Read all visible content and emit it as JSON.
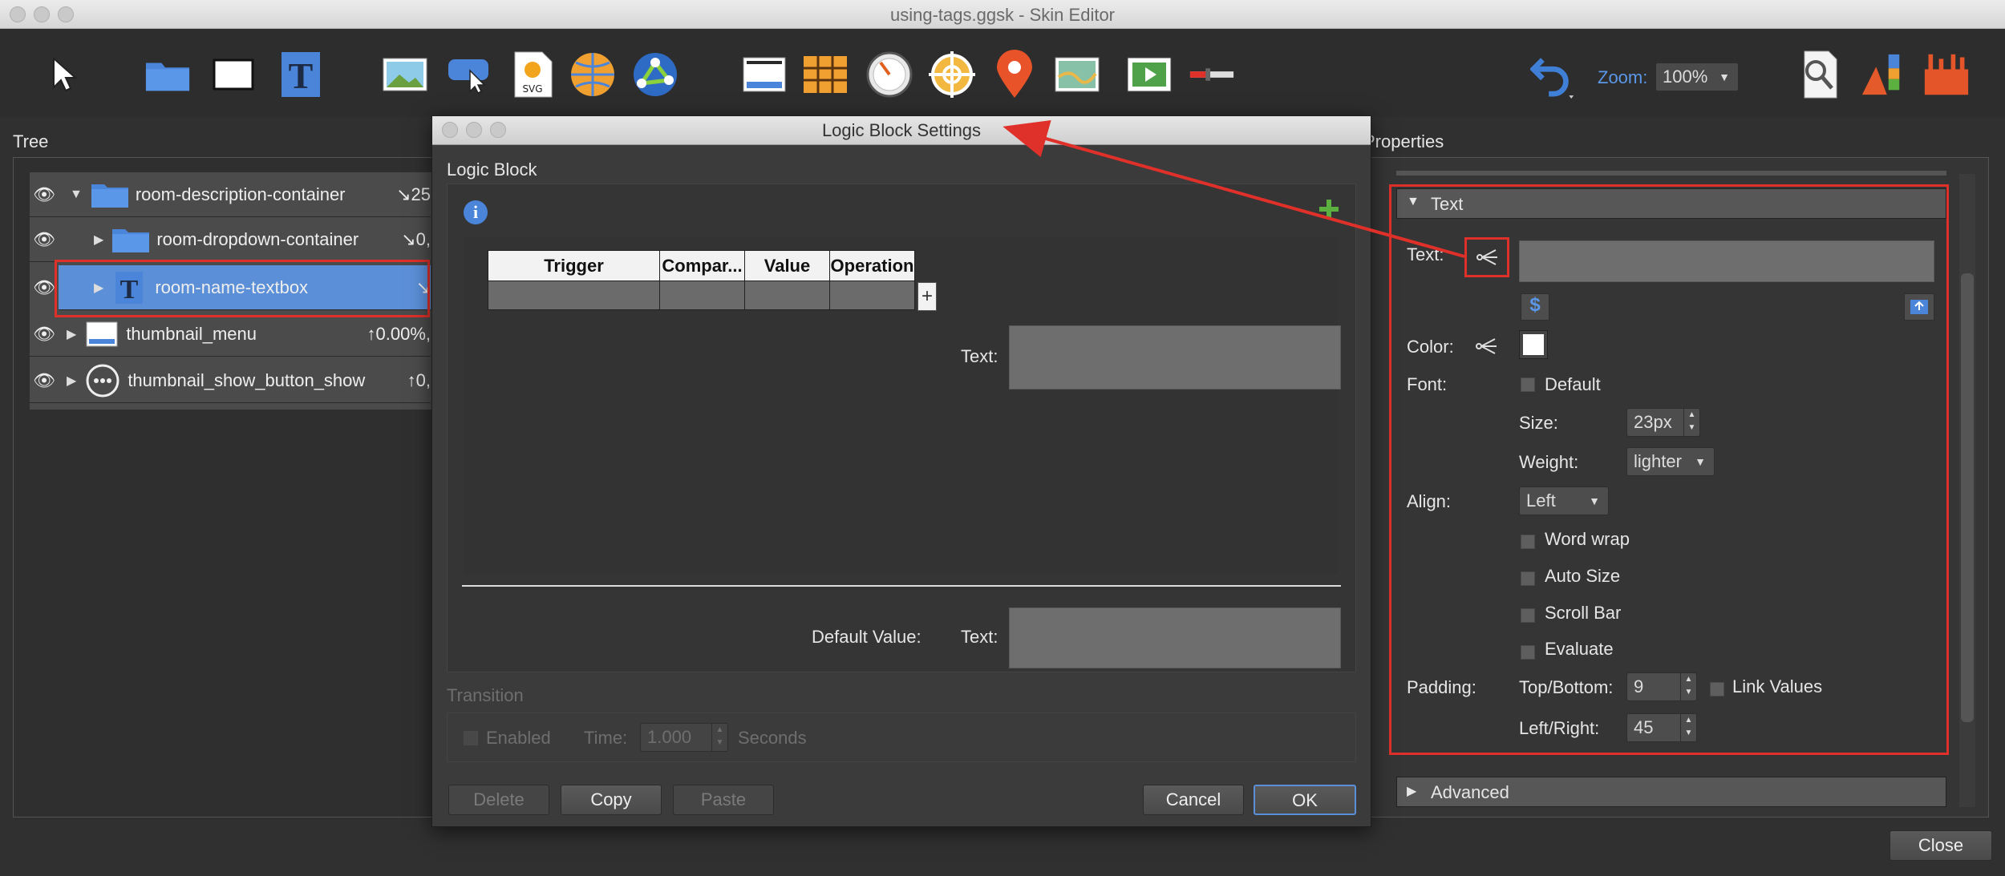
{
  "window": {
    "title": "using-tags.ggsk - Skin Editor"
  },
  "toolbar": {
    "tools": [
      "pointer-icon",
      "folder-icon",
      "rectangle-icon",
      "text-icon",
      "image-icon",
      "cloud-button-icon",
      "svg-icon",
      "hotspot-icon",
      "map-node-icon",
      "container-icon",
      "grid-icon",
      "dial-icon",
      "crosshair-icon",
      "map-pin-icon",
      "map-icon",
      "video-icon",
      "slider-icon"
    ],
    "svg_label": "SVG",
    "zoom_label": "Zoom:",
    "zoom_value": "100%"
  },
  "tree": {
    "header": "Tree",
    "items": [
      {
        "label": "room-description-container",
        "info": "↘25"
      },
      {
        "label": "room-dropdown-container",
        "info": "↘0,"
      },
      {
        "label": "room-name-textbox",
        "info": "↘"
      },
      {
        "label": "thumbnail_menu",
        "info": "↑0.00%,"
      },
      {
        "label": "thumbnail_show_button_show",
        "info": "↑0,"
      }
    ]
  },
  "dialog": {
    "title": "Logic Block Settings",
    "section": "Logic Block",
    "columns": [
      "Trigger",
      "Compar...",
      "Value",
      "Operation"
    ],
    "text_label": "Text:",
    "default_value_label": "Default Value:",
    "default_text_label": "Text:",
    "transition": {
      "header": "Transition",
      "enabled": "Enabled",
      "time_label": "Time:",
      "time_value": "1.000",
      "seconds": "Seconds"
    },
    "buttons": {
      "delete": "Delete",
      "copy": "Copy",
      "paste": "Paste",
      "cancel": "Cancel",
      "ok": "OK"
    }
  },
  "properties": {
    "header": "Properties",
    "text_section": "Text",
    "text_label": "Text:",
    "color_label": "Color:",
    "font_label": "Font:",
    "default_option": "Default",
    "size_label": "Size:",
    "size_value": "23px",
    "weight_label": "Weight:",
    "weight_value": "lighter",
    "align_label": "Align:",
    "align_value": "Left",
    "word_wrap": "Word wrap",
    "auto_size": "Auto Size",
    "scroll_bar": "Scroll Bar",
    "evaluate": "Evaluate",
    "padding_label": "Padding:",
    "top_bottom_label": "Top/Bottom:",
    "top_bottom_value": "9",
    "link_values": "Link Values",
    "left_right_label": "Left/Right:",
    "left_right_value": "45",
    "advanced_section": "Advanced",
    "dollar_symbol": "$"
  },
  "footer": {
    "close": "Close"
  },
  "colors": {
    "accent_blue": "#4a85d9",
    "annotation_red": "#e0302a",
    "selection_blue": "#5b8fd8"
  }
}
